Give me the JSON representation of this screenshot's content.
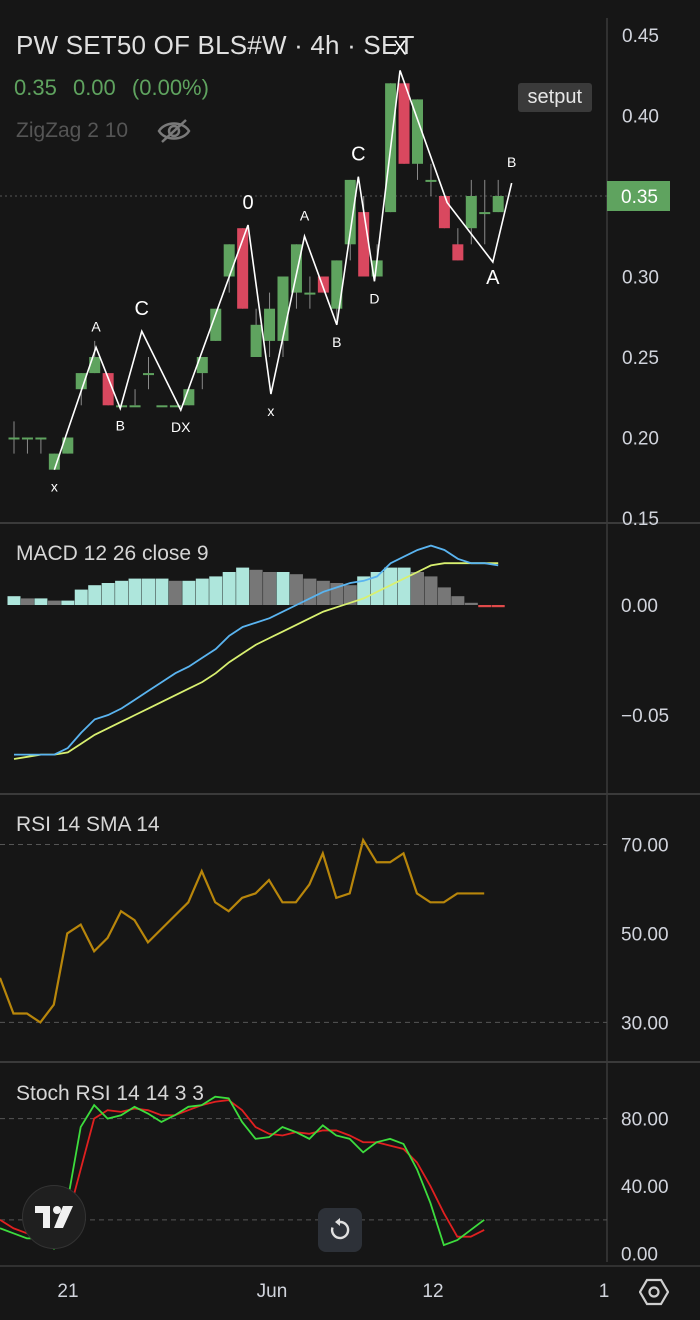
{
  "header": {
    "title": "PW SET50 OF BLS#W · 4h · SET",
    "quote": {
      "price": "0.35",
      "change": "0.00",
      "change_pct": "(0.00%)"
    },
    "indicator": "ZigZag 2 10",
    "setput_label": "setput"
  },
  "colors": {
    "up": "#5fa35f",
    "down": "#d9485f",
    "macd_line": "#5ab4f0",
    "signal_line": "#d8f070",
    "hist_pos": "#aee6dc",
    "hist_pos_fall": "#777777",
    "hist_neg": "#e04a4a",
    "rsi": "#b8860b",
    "stoch_k": "#3ddc3d",
    "stoch_d": "#e02020",
    "price_tag": "#5fa35f"
  },
  "chart_data": [
    {
      "type": "candlestick",
      "title": "PW SET50 OF BLS#W · 4h · SET",
      "ylim": [
        0.15,
        0.46
      ],
      "yticks": [
        "0.45",
        "0.40",
        "0.35",
        "0.30",
        "0.25",
        "0.20",
        "0.15"
      ],
      "last_price_label": "0.35",
      "last_price": 0.35,
      "xticks": [
        "21",
        "Jun",
        "12",
        "1"
      ],
      "candles": [
        {
          "o": 0.2,
          "h": 0.21,
          "l": 0.19,
          "c": 0.2
        },
        {
          "o": 0.2,
          "h": 0.2,
          "l": 0.19,
          "c": 0.2
        },
        {
          "o": 0.2,
          "h": 0.2,
          "l": 0.19,
          "c": 0.2
        },
        {
          "o": 0.18,
          "h": 0.19,
          "l": 0.18,
          "c": 0.19
        },
        {
          "o": 0.19,
          "h": 0.2,
          "l": 0.19,
          "c": 0.2
        },
        {
          "o": 0.23,
          "h": 0.24,
          "l": 0.22,
          "c": 0.24
        },
        {
          "o": 0.24,
          "h": 0.26,
          "l": 0.24,
          "c": 0.25
        },
        {
          "o": 0.24,
          "h": 0.24,
          "l": 0.22,
          "c": 0.22
        },
        {
          "o": 0.22,
          "h": 0.22,
          "l": 0.22,
          "c": 0.22
        },
        {
          "o": 0.22,
          "h": 0.23,
          "l": 0.22,
          "c": 0.22
        },
        {
          "o": 0.24,
          "h": 0.25,
          "l": 0.23,
          "c": 0.24
        },
        {
          "o": 0.22,
          "h": 0.22,
          "l": 0.22,
          "c": 0.22
        },
        {
          "o": 0.22,
          "h": 0.22,
          "l": 0.22,
          "c": 0.22
        },
        {
          "o": 0.22,
          "h": 0.23,
          "l": 0.22,
          "c": 0.23
        },
        {
          "o": 0.24,
          "h": 0.25,
          "l": 0.23,
          "c": 0.25
        },
        {
          "o": 0.26,
          "h": 0.28,
          "l": 0.26,
          "c": 0.28
        },
        {
          "o": 0.3,
          "h": 0.32,
          "l": 0.29,
          "c": 0.32
        },
        {
          "o": 0.33,
          "h": 0.33,
          "l": 0.28,
          "c": 0.28
        },
        {
          "o": 0.25,
          "h": 0.28,
          "l": 0.25,
          "c": 0.27
        },
        {
          "o": 0.26,
          "h": 0.29,
          "l": 0.25,
          "c": 0.28
        },
        {
          "o": 0.26,
          "h": 0.3,
          "l": 0.25,
          "c": 0.3
        },
        {
          "o": 0.29,
          "h": 0.32,
          "l": 0.28,
          "c": 0.32
        },
        {
          "o": 0.29,
          "h": 0.3,
          "l": 0.28,
          "c": 0.29
        },
        {
          "o": 0.3,
          "h": 0.3,
          "l": 0.29,
          "c": 0.29
        },
        {
          "o": 0.28,
          "h": 0.31,
          "l": 0.27,
          "c": 0.31
        },
        {
          "o": 0.32,
          "h": 0.36,
          "l": 0.31,
          "c": 0.36
        },
        {
          "o": 0.34,
          "h": 0.35,
          "l": 0.3,
          "c": 0.3
        },
        {
          "o": 0.3,
          "h": 0.32,
          "l": 0.3,
          "c": 0.31
        },
        {
          "o": 0.34,
          "h": 0.42,
          "l": 0.34,
          "c": 0.42
        },
        {
          "o": 0.42,
          "h": 0.42,
          "l": 0.37,
          "c": 0.37
        },
        {
          "o": 0.37,
          "h": 0.41,
          "l": 0.36,
          "c": 0.41
        },
        {
          "o": 0.36,
          "h": 0.37,
          "l": 0.35,
          "c": 0.36
        },
        {
          "o": 0.35,
          "h": 0.35,
          "l": 0.33,
          "c": 0.33
        },
        {
          "o": 0.32,
          "h": 0.33,
          "l": 0.31,
          "c": 0.31
        },
        {
          "o": 0.33,
          "h": 0.36,
          "l": 0.32,
          "c": 0.35
        },
        {
          "o": 0.34,
          "h": 0.36,
          "l": 0.32,
          "c": 0.34
        },
        {
          "o": 0.34,
          "h": 0.36,
          "l": 0.34,
          "c": 0.35
        }
      ],
      "zigzag": [
        {
          "i": 3.0,
          "p": 0.18,
          "label": "x",
          "pos": "below"
        },
        {
          "i": 6.1,
          "p": 0.256,
          "label": "A",
          "pos": "above"
        },
        {
          "i": 7.9,
          "p": 0.218,
          "label": "B",
          "pos": "below"
        },
        {
          "i": 9.5,
          "p": 0.266,
          "label": "C",
          "pos": "above"
        },
        {
          "i": 12.4,
          "p": 0.217,
          "label": "DX",
          "pos": "below"
        },
        {
          "i": 17.4,
          "p": 0.332,
          "label": "0",
          "pos": "above"
        },
        {
          "i": 19.1,
          "p": 0.227,
          "label": "x",
          "pos": "below"
        },
        {
          "i": 21.6,
          "p": 0.325,
          "label": "A",
          "pos": "above"
        },
        {
          "i": 24.0,
          "p": 0.27,
          "label": "B",
          "pos": "below"
        },
        {
          "i": 25.6,
          "p": 0.362,
          "label": "C",
          "pos": "above"
        },
        {
          "i": 26.8,
          "p": 0.297,
          "label": "D",
          "pos": "below"
        },
        {
          "i": 28.7,
          "p": 0.428,
          "label": "X",
          "pos": "above"
        },
        {
          "i": 32.2,
          "p": 0.346,
          "label": "",
          "pos": "none"
        },
        {
          "i": 35.6,
          "p": 0.309,
          "label": "A",
          "pos": "below"
        },
        {
          "i": 37.0,
          "p": 0.358,
          "label": "B",
          "pos": "above"
        }
      ]
    },
    {
      "type": "macd",
      "title": "MACD 12 26 close 9",
      "ylim": [
        -0.085,
        0.035
      ],
      "yticks": [
        "0.00",
        "−0.05"
      ],
      "histogram": [
        0.004,
        0.003,
        0.003,
        0.002,
        0.002,
        0.007,
        0.009,
        0.01,
        0.011,
        0.012,
        0.012,
        0.012,
        0.011,
        0.011,
        0.012,
        0.013,
        0.015,
        0.017,
        0.016,
        0.015,
        0.015,
        0.014,
        0.012,
        0.011,
        0.01,
        0.009,
        0.013,
        0.015,
        0.017,
        0.017,
        0.015,
        0.013,
        0.008,
        0.004,
        0.001,
        -0.001,
        -0.001
      ],
      "macd": [
        -0.068,
        -0.068,
        -0.068,
        -0.068,
        -0.065,
        -0.058,
        -0.052,
        -0.05,
        -0.047,
        -0.043,
        -0.039,
        -0.035,
        -0.031,
        -0.028,
        -0.024,
        -0.02,
        -0.014,
        -0.01,
        -0.008,
        -0.006,
        -0.003,
        0.0,
        0.003,
        0.006,
        0.008,
        0.01,
        0.011,
        0.013,
        0.019,
        0.022,
        0.025,
        0.027,
        0.025,
        0.021,
        0.019,
        0.019,
        0.018
      ],
      "signal": [
        -0.07,
        -0.069,
        -0.068,
        -0.068,
        -0.067,
        -0.063,
        -0.059,
        -0.056,
        -0.053,
        -0.05,
        -0.047,
        -0.044,
        -0.041,
        -0.038,
        -0.035,
        -0.031,
        -0.026,
        -0.022,
        -0.018,
        -0.015,
        -0.012,
        -0.009,
        -0.006,
        -0.003,
        -0.001,
        0.001,
        0.003,
        0.006,
        0.009,
        0.012,
        0.015,
        0.018,
        0.019,
        0.019,
        0.019,
        0.019,
        0.019
      ]
    },
    {
      "type": "line",
      "title": "RSI 14 SMA 14",
      "ylim": [
        22,
        80
      ],
      "yticks": [
        "70.00",
        "50.00",
        "30.00"
      ],
      "rsi": [
        40,
        32,
        32,
        30,
        34,
        50,
        52,
        46,
        49,
        55,
        53,
        48,
        51,
        54,
        57,
        64,
        57,
        55,
        58,
        59,
        62,
        57,
        57,
        61,
        68,
        58,
        59,
        71,
        66,
        66,
        68,
        59,
        57,
        57,
        59,
        59,
        59
      ]
    },
    {
      "type": "line",
      "title": "Stoch RSI 14 14 3 3",
      "ylim": [
        -5,
        110
      ],
      "yticks": [
        "80.00",
        "40.00",
        "0.00"
      ],
      "stoch_k": [
        15,
        12,
        9,
        9,
        3,
        30,
        75,
        88,
        80,
        82,
        87,
        83,
        78,
        82,
        87,
        88,
        93,
        92,
        78,
        68,
        69,
        75,
        72,
        68,
        76,
        70,
        68,
        60,
        66,
        68,
        65,
        50,
        30,
        5,
        8,
        14,
        20
      ],
      "stoch_d": [
        20,
        15,
        12,
        10,
        5,
        20,
        50,
        80,
        85,
        84,
        86,
        85,
        82,
        82,
        85,
        88,
        90,
        91,
        85,
        75,
        71,
        70,
        72,
        71,
        73,
        73,
        70,
        66,
        66,
        64,
        62,
        54,
        40,
        24,
        10,
        10,
        14
      ]
    }
  ]
}
